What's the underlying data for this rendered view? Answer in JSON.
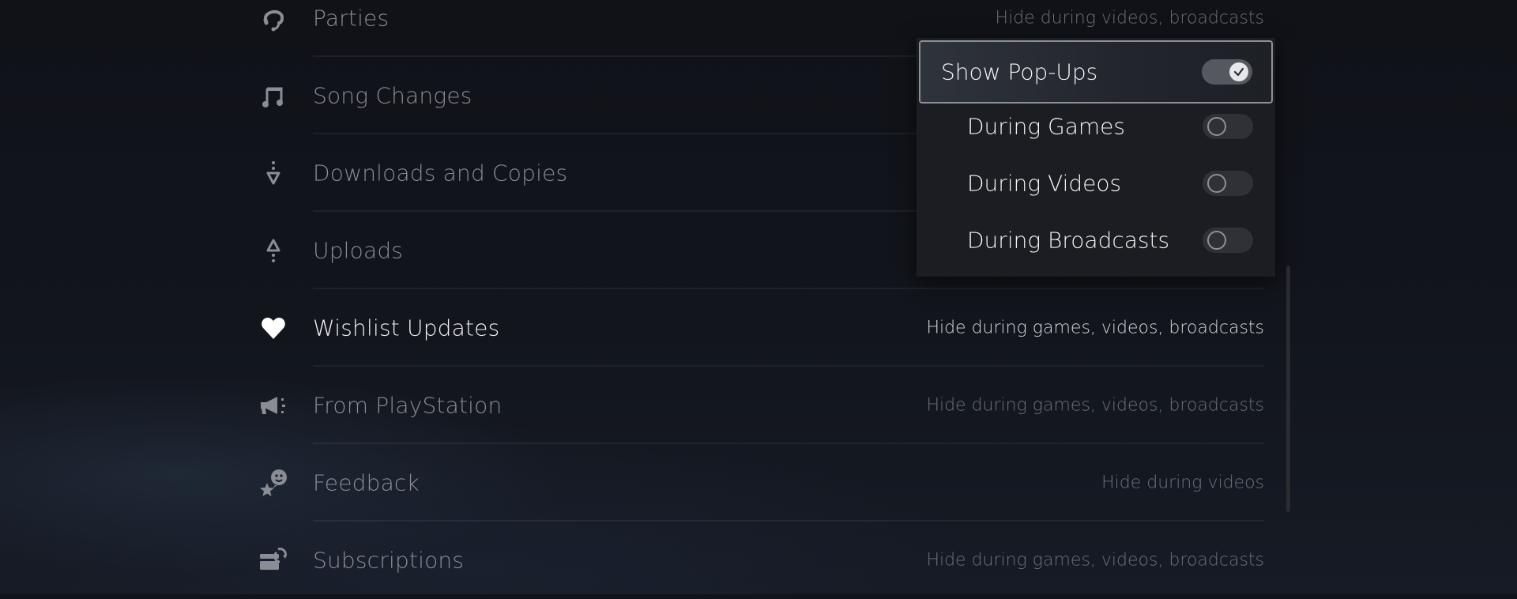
{
  "settings_list": [
    {
      "label": "Parties",
      "value": "Hide during videos, broadcasts",
      "icon": "headset-icon",
      "active": false
    },
    {
      "label": "Song Changes",
      "value": "",
      "icon": "music-note-icon",
      "active": false
    },
    {
      "label": "Downloads and Copies",
      "value": "",
      "icon": "download-icon",
      "active": false
    },
    {
      "label": "Uploads",
      "value": "",
      "icon": "upload-icon",
      "active": false
    },
    {
      "label": "Wishlist Updates",
      "value": "Hide during games, videos, broadcasts",
      "icon": "heart-icon",
      "active": true
    },
    {
      "label": "From PlayStation",
      "value": "Hide during games, videos, broadcasts",
      "icon": "megaphone-icon",
      "active": false
    },
    {
      "label": "Feedback",
      "value": "Hide during videos",
      "icon": "feedback-icon",
      "active": false
    },
    {
      "label": "Subscriptions",
      "value": "Hide during games, videos, broadcasts",
      "icon": "subscription-icon",
      "active": false
    }
  ],
  "popup": {
    "header": {
      "label": "Show Pop-Ups",
      "checked": true
    },
    "options": [
      {
        "label": "During Games",
        "checked": false
      },
      {
        "label": "During Videos",
        "checked": false
      },
      {
        "label": "During Broadcasts",
        "checked": false
      }
    ]
  },
  "colors": {
    "background": "#11131a",
    "active_text": "#f2f3f5",
    "inactive_text": "#8a8d94",
    "popup_border": "#8c8f96"
  }
}
